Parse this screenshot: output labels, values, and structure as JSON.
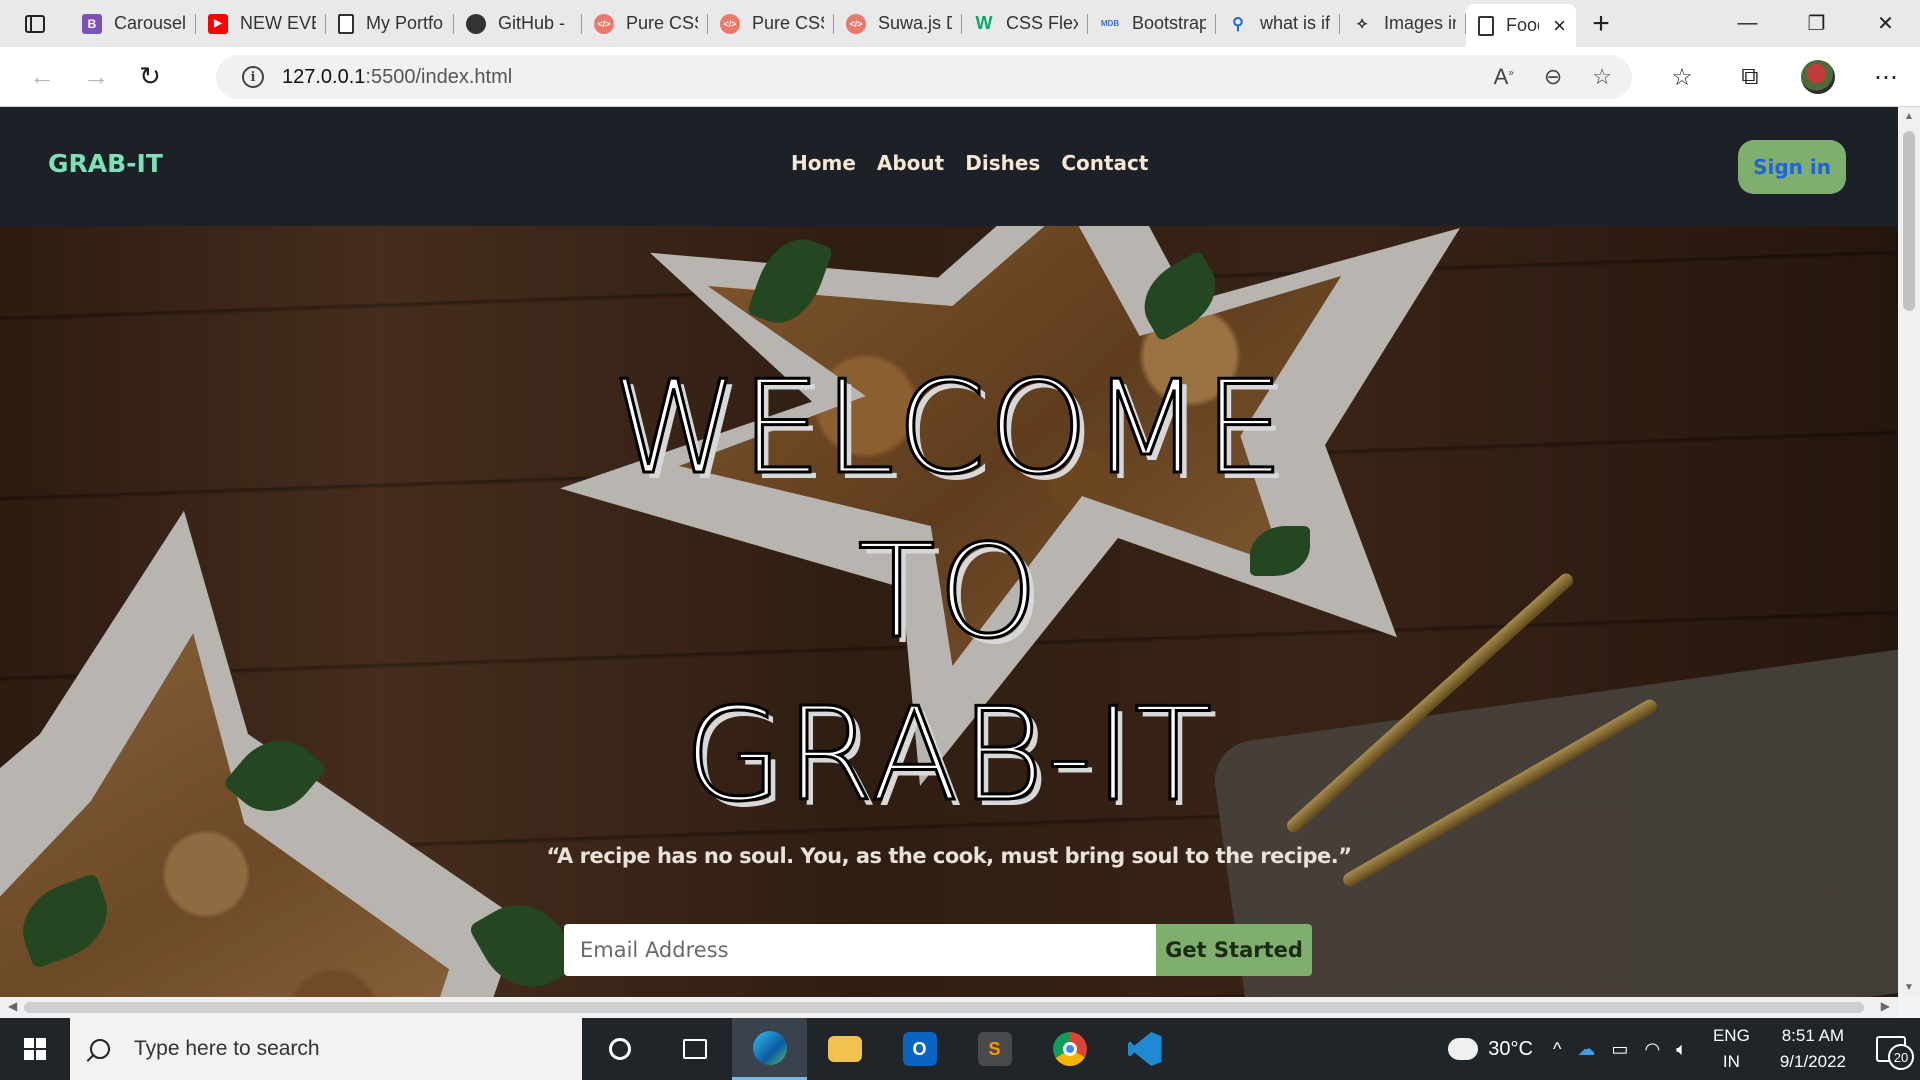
{
  "browser": {
    "tabs": [
      {
        "title": "Carousel",
        "icon": "bootstrap-icon",
        "color": "#7952b3",
        "glyph": "B"
      },
      {
        "title": "NEW EVE",
        "icon": "youtube-icon",
        "color": "#ff0000",
        "glyph": "▶"
      },
      {
        "title": "My Portfo",
        "icon": "page-icon",
        "color": "#ffffff",
        "glyph": ""
      },
      {
        "title": "GitHub -",
        "icon": "github-icon",
        "color": "#333333",
        "glyph": "●"
      },
      {
        "title": "Pure CSS",
        "icon": "codepen-icon",
        "color": "#e8796b",
        "glyph": "</>"
      },
      {
        "title": "Pure CSS",
        "icon": "codepen-icon",
        "color": "#e8796b",
        "glyph": "</>"
      },
      {
        "title": "Suwa.js D",
        "icon": "codepen-icon",
        "color": "#e8796b",
        "glyph": "</>"
      },
      {
        "title": "CSS Flexb",
        "icon": "w3-icon",
        "color": "#04aa6d",
        "glyph": "W"
      },
      {
        "title": "Bootstrap",
        "icon": "mdb-icon",
        "color": "#3b71ca",
        "glyph": "MDB"
      },
      {
        "title": "what is if",
        "icon": "search-icon",
        "color": "#1e66d6",
        "glyph": "⚲"
      },
      {
        "title": "Images in",
        "icon": "code-icon",
        "color": "#333333",
        "glyph": "⟡"
      }
    ],
    "active_tab": {
      "title": "Food",
      "icon": "page-icon"
    },
    "new_tab": "+",
    "url_host": "127.0.0.1",
    "url_rest": ":5500/index.html"
  },
  "site": {
    "logo": "GRAB-IT",
    "nav": [
      "Home",
      "About",
      "Dishes",
      "Contact"
    ],
    "signin": "Sign in",
    "hero": {
      "line1": "WELCOME",
      "line2": "TO",
      "line3": "GRAB-IT",
      "quote": "“A recipe has no soul. You, as the cook, must bring soul to the recipe.”",
      "email_placeholder": "Email Address",
      "cta": "Get Started"
    }
  },
  "taskbar": {
    "search_placeholder": "Type here to search",
    "apps": [
      {
        "name": "cortana-icon"
      },
      {
        "name": "task-view-icon"
      },
      {
        "name": "edge-icon",
        "active": true
      },
      {
        "name": "file-explorer-icon"
      },
      {
        "name": "outlook-icon"
      },
      {
        "name": "sublime-text-icon"
      },
      {
        "name": "chrome-icon"
      },
      {
        "name": "vscode-icon"
      }
    ],
    "weather": "30°C",
    "lang1": "ENG",
    "lang2": "IN",
    "time": "8:51 AM",
    "date": "9/1/2022",
    "notifications": "20"
  },
  "colors": {
    "accent_green": "#7fae6f",
    "logo_teal": "#7ee0b7",
    "nav_bg": "#1c2128",
    "signin_text": "#1f64d8"
  }
}
